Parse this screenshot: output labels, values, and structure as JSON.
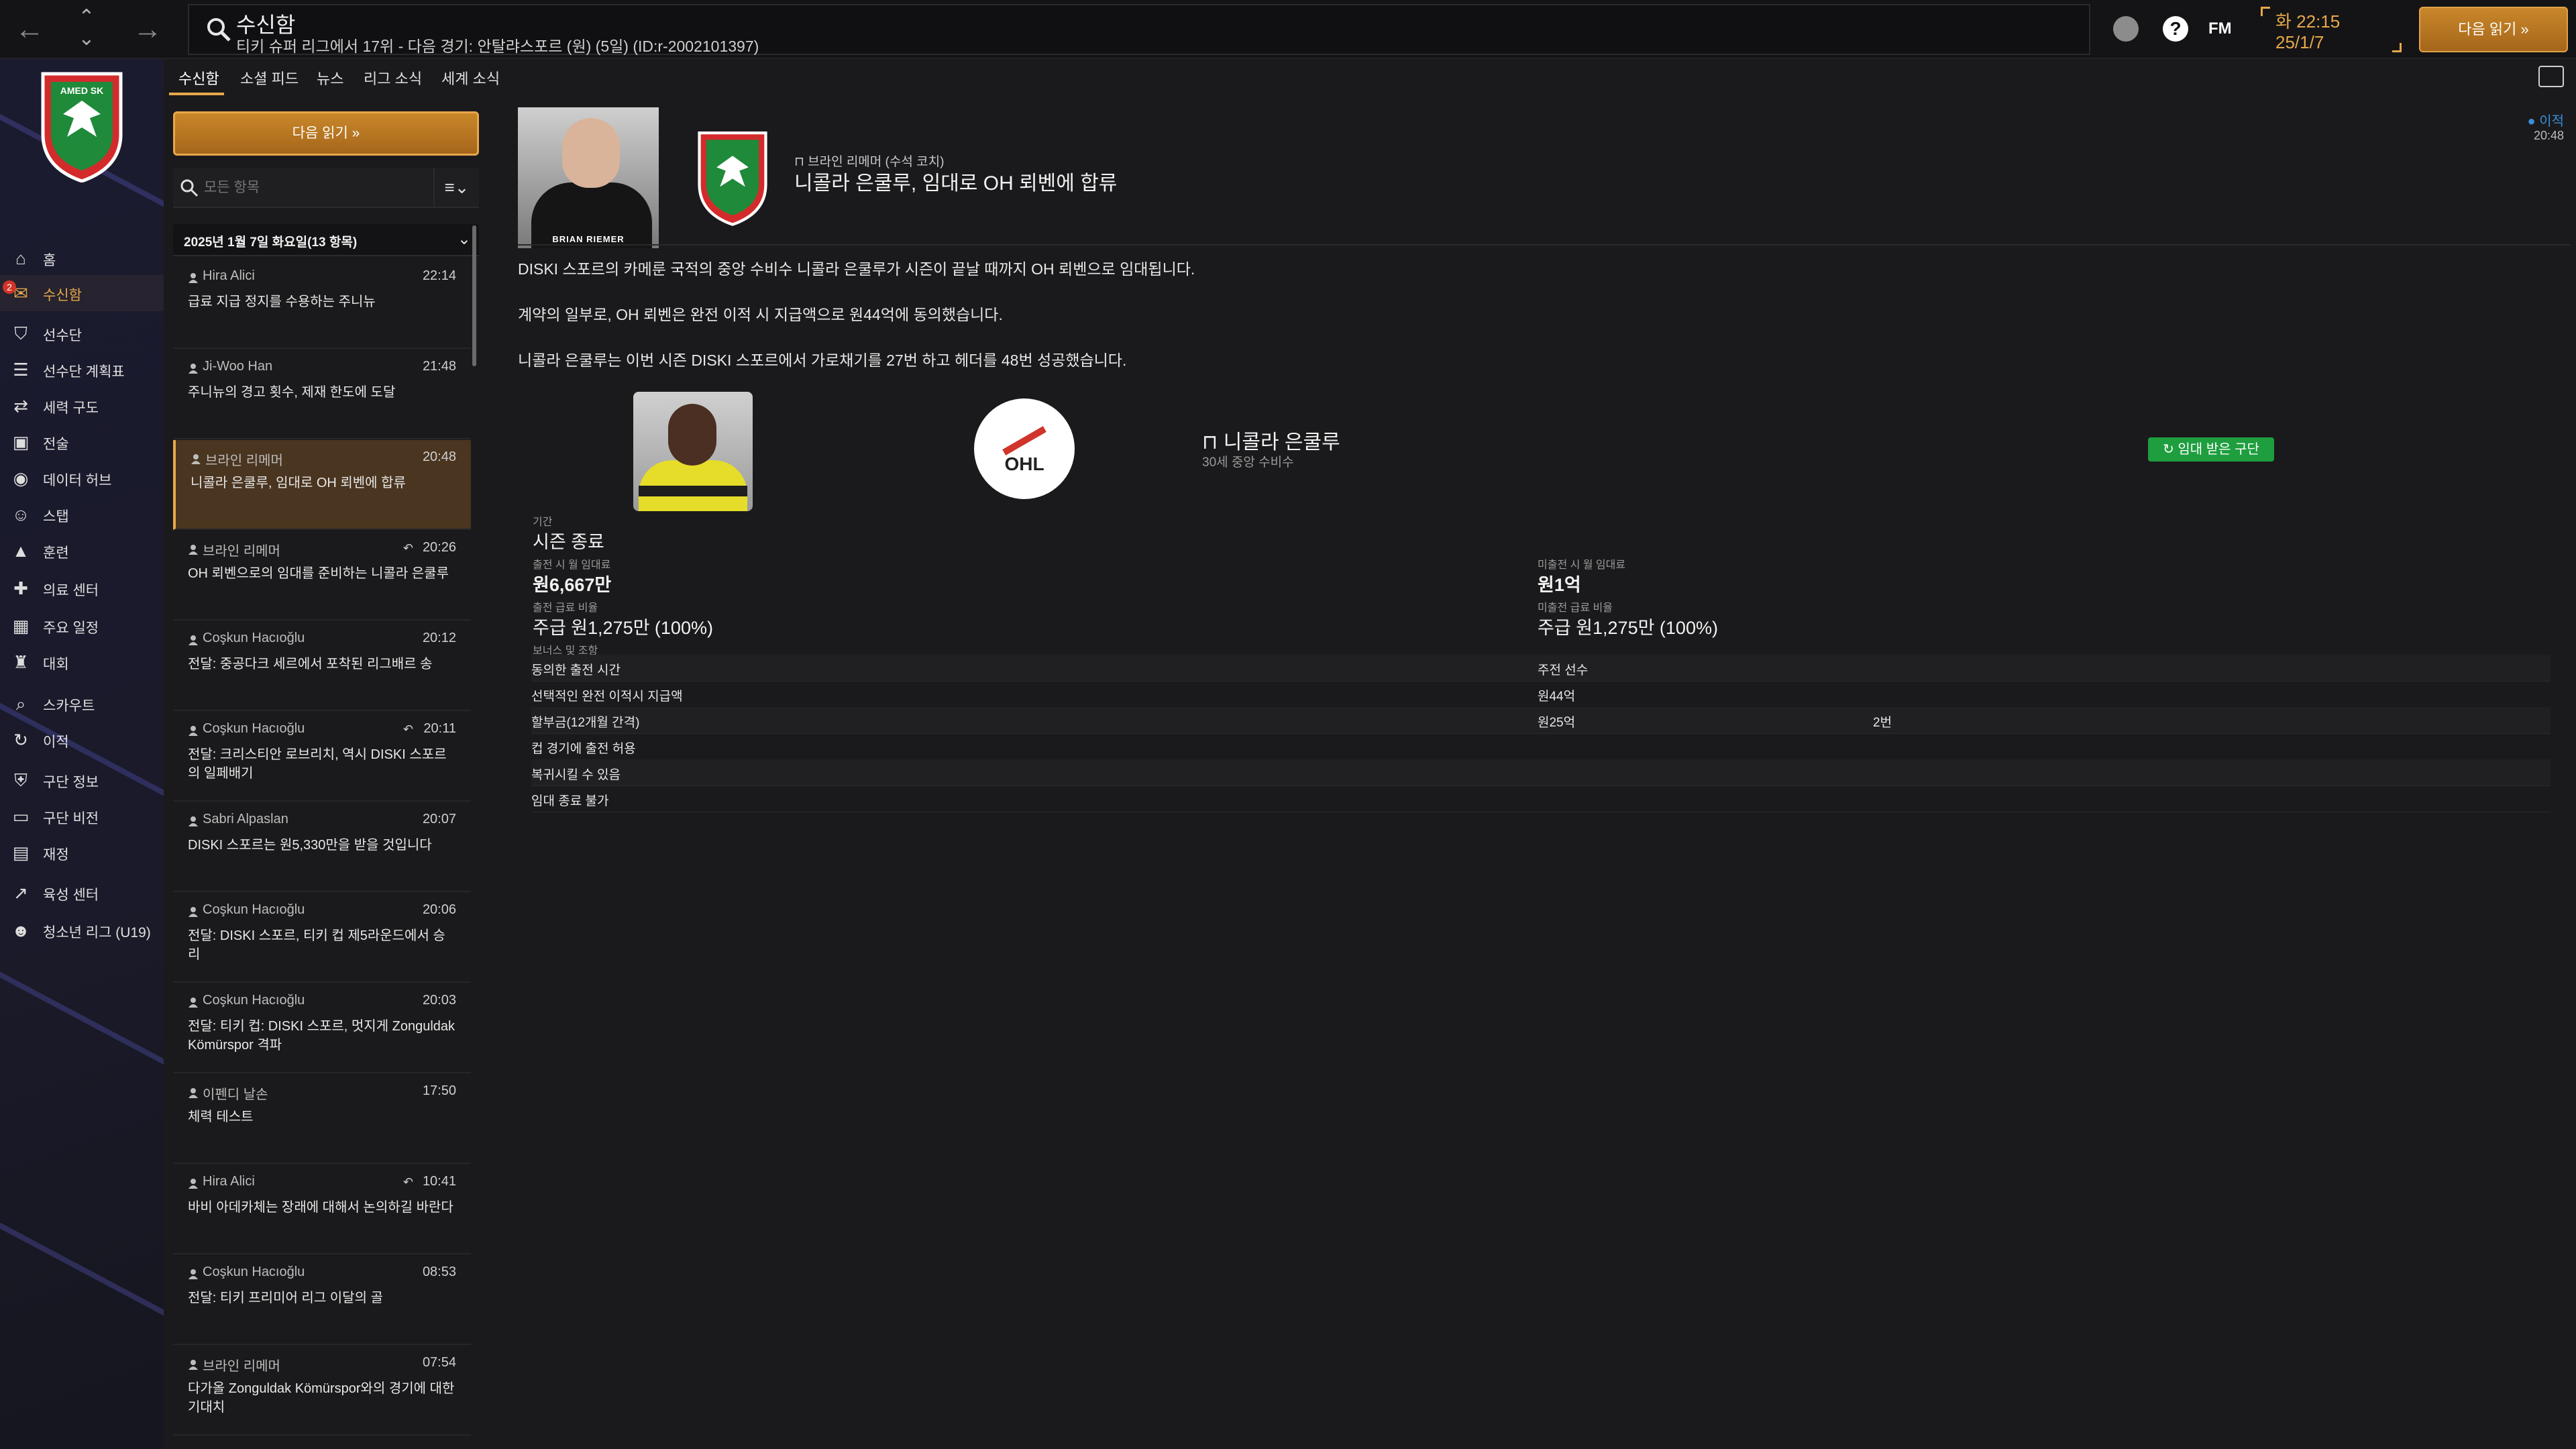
{
  "topbar": {
    "title": "수신함",
    "subtitle": "티키 슈퍼 리그에서 17위 - 다음 경기: 안탈랴스포르 (원) (5일) (ID:r-2002101397)",
    "clock_time": "화 22:15",
    "clock_date": "25/1/7",
    "continue_label": "다음 읽기",
    "fm_label": "FM",
    "help_label": "?"
  },
  "sidebar": {
    "badge_count": "2",
    "items": [
      {
        "label": "홈",
        "icon": "home-icon"
      },
      {
        "label": "수신함",
        "icon": "inbox-icon"
      },
      {
        "label": "선수단",
        "icon": "squad-icon"
      },
      {
        "label": "선수단 계획표",
        "icon": "planner-icon"
      },
      {
        "label": "세력 구도",
        "icon": "dynamics-icon"
      },
      {
        "label": "전술",
        "icon": "tactics-icon"
      },
      {
        "label": "데이터 허브",
        "icon": "data-hub-icon"
      },
      {
        "label": "스탭",
        "icon": "staff-icon"
      },
      {
        "label": "훈련",
        "icon": "training-icon"
      },
      {
        "label": "의료 센터",
        "icon": "medical-icon"
      },
      {
        "label": "주요 일정",
        "icon": "calendar-icon"
      },
      {
        "label": "대회",
        "icon": "trophy-icon"
      },
      {
        "label": "스카우트",
        "icon": "scouting-icon"
      },
      {
        "label": "이적",
        "icon": "transfer-icon"
      },
      {
        "label": "구단 정보",
        "icon": "club-info-icon"
      },
      {
        "label": "구단 비전",
        "icon": "club-vision-icon"
      },
      {
        "label": "재정",
        "icon": "finances-icon"
      },
      {
        "label": "육성 센터",
        "icon": "dev-centre-icon"
      },
      {
        "label": "청소년 리그 (U19)",
        "icon": "youth-icon"
      }
    ]
  },
  "tabs": [
    "수신함",
    "소셜 피드",
    "뉴스",
    "리그 소식",
    "세계 소식"
  ],
  "inbox": {
    "continue_label": "다음 읽기",
    "search_placeholder": "모든 항목",
    "date_header": "2025년 1월 7일 화요일(13 항목)",
    "messages": [
      {
        "sender": "Hira Alici",
        "time": "22:14",
        "subject": "급료 지급 정지를 수용하는 주니뉴",
        "reply": false
      },
      {
        "sender": "Ji-Woo Han",
        "time": "21:48",
        "subject": "주니뉴의 경고 횟수, 제재 한도에 도달",
        "reply": false
      },
      {
        "sender": "브라인 리메머",
        "time": "20:48",
        "subject": "니콜라 은쿨루, 임대로 OH 뢰벤에 합류",
        "reply": false
      },
      {
        "sender": "브라인 리메머",
        "time": "20:26",
        "subject": "OH 뢰벤으로의 임대를 준비하는 니콜라 은쿨루",
        "reply": true
      },
      {
        "sender": "Coşkun Hacıoğlu",
        "time": "20:12",
        "subject": "전달: 중공다크 세르에서 포착된 리그배르 송",
        "reply": false
      },
      {
        "sender": "Coşkun Hacıoğlu",
        "time": "20:11",
        "subject": "전달: 크리스티안 로브리치, 역시 DISKI 스포르의 일페배기",
        "reply": true
      },
      {
        "sender": "Sabri Alpaslan",
        "time": "20:07",
        "subject": "DISKI 스포르는 원5,330만을 받을 것입니다",
        "reply": false
      },
      {
        "sender": "Coşkun Hacıoğlu",
        "time": "20:06",
        "subject": "전달: DISKI 스포르, 티키 컵 제5라운드에서 승리",
        "reply": false
      },
      {
        "sender": "Coşkun Hacıoğlu",
        "time": "20:03",
        "subject": "전달: 티키 컵: DISKI 스포르, 멋지게 Zonguldak Kömürspor 격파",
        "reply": false
      },
      {
        "sender": "이펜디 날손",
        "time": "17:50",
        "subject": "체력 테스트",
        "reply": false
      },
      {
        "sender": "Hira Alici",
        "time": "10:41",
        "subject": "바비 아데카체는 장래에 대해서 논의하길 바란다",
        "reply": true
      },
      {
        "sender": "Coşkun Hacıoğlu",
        "time": "08:53",
        "subject": "전달: 티키 프리미어 리그 이달의 골",
        "reply": false
      },
      {
        "sender": "브라인 리메머",
        "time": "07:54",
        "subject": "다가올 Zonguldak Kömürspor와의 경기에 대한 기대치",
        "reply": false
      }
    ]
  },
  "article": {
    "manager_caption": "BRIAN RIEMER",
    "from": "브라인 리메머 (수석 코치)",
    "title": "니콜라 은쿨루, 임대로 OH 뢰벤에 합류",
    "tag": "이적",
    "tag_time": "20:48",
    "paragraphs": [
      "DISKI 스포르의 카메룬 국적의 중앙 수비수 니콜라 은쿨루가 시즌이 끝날 때까지 OH 뢰벤으로 임대됩니다.",
      "계약의 일부로, OH 뢰벤은 완전 이적 시 지급액으로 원44억에 동의했습니다.",
      "니콜라 은쿨루는 이번 시즌 DISKI 스포르에서 가로채기를 27번 하고 헤더를 48번 성공했습니다."
    ],
    "club_badge_text": "OHL",
    "player_name": "니콜라 은쿨루",
    "player_sub": "30세 중앙 수비수",
    "loan_badge": "임대 받은 구단",
    "terms": {
      "period_label": "기간",
      "period_value": "시즌 종료",
      "fee_played_label": "출전 시 월 임대료",
      "fee_played_value": "원6,667만",
      "fee_unplayed_label": "미출전 시 월 임대료",
      "fee_unplayed_value": "원1억",
      "wage_played_label": "출전 급료 비율",
      "wage_played_value": "주급 원1,275만 (100%)",
      "wage_unplayed_label": "미출전 급료 비율",
      "wage_unplayed_value": "주급 원1,275만 (100%)",
      "bonus_label": "보너스 및 조항"
    },
    "conditions": [
      [
        "동의한 출전 시간",
        "주전 선수",
        ""
      ],
      [
        "선택적인 완전 이적시 지급액",
        "원44억",
        ""
      ],
      [
        "할부금(12개월 간격)",
        "원25억",
        "2번"
      ],
      [
        "컵 경기에 출전 허용",
        "",
        ""
      ],
      [
        "복귀시킬 수 있음",
        "",
        ""
      ],
      [
        "임대 종료 불가",
        "",
        ""
      ]
    ]
  },
  "colors": {
    "accent": "#e6a84a",
    "loan_green": "#1e9e3e",
    "tag_blue": "#3b8dd8"
  }
}
